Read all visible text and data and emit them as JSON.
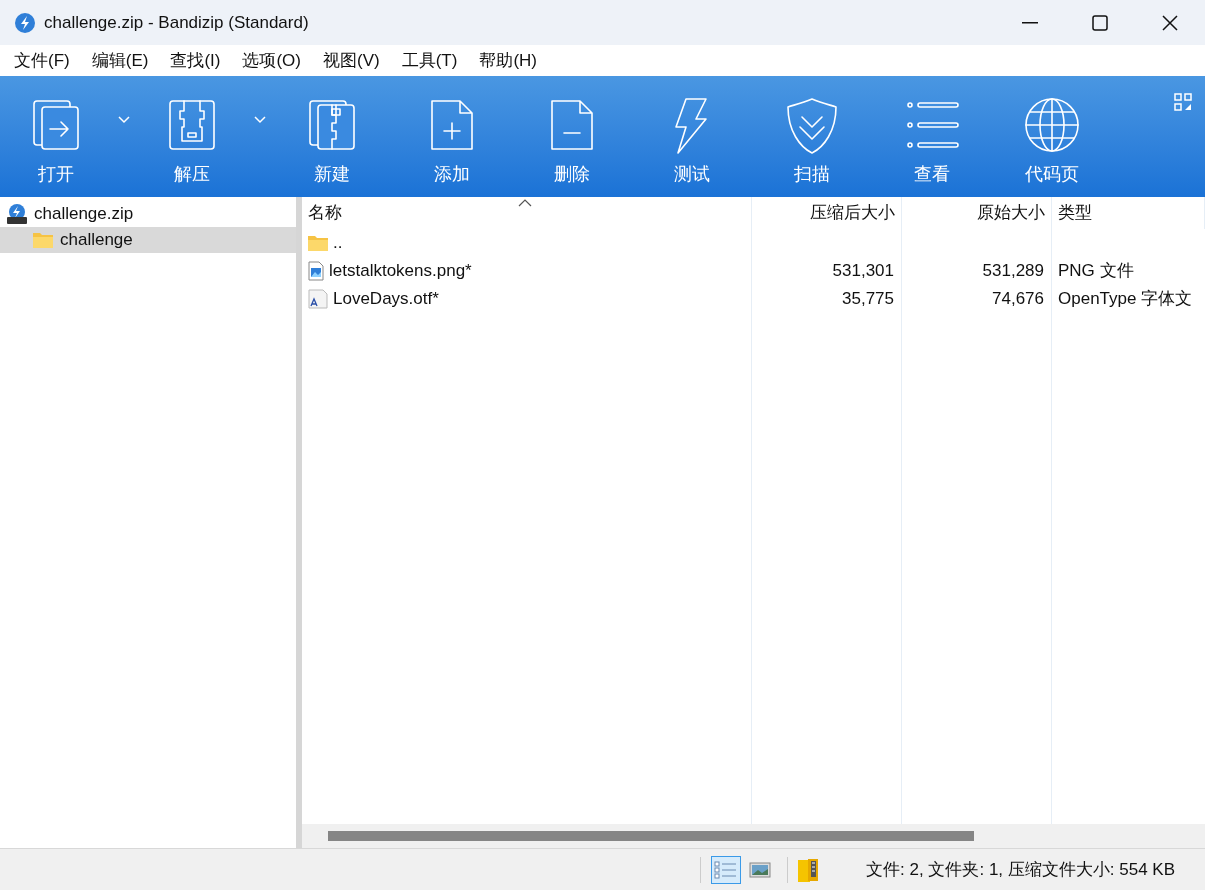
{
  "window": {
    "title": "challenge.zip - Bandizip (Standard)"
  },
  "menu": [
    "文件(F)",
    "编辑(E)",
    "查找(I)",
    "选项(O)",
    "视图(V)",
    "工具(T)",
    "帮助(H)"
  ],
  "toolbar": [
    {
      "label": "打开",
      "dropdown": true
    },
    {
      "label": "解压",
      "dropdown": true
    },
    {
      "label": "新建",
      "dropdown": false
    },
    {
      "label": "添加",
      "dropdown": false
    },
    {
      "label": "删除",
      "dropdown": false
    },
    {
      "label": "测试",
      "dropdown": false
    },
    {
      "label": "扫描",
      "dropdown": false
    },
    {
      "label": "查看",
      "dropdown": false
    },
    {
      "label": "代码页",
      "dropdown": false
    }
  ],
  "tree": [
    {
      "label": "challenge.zip",
      "kind": "archive",
      "selected": false,
      "children": [
        {
          "label": "challenge",
          "kind": "folder",
          "selected": true
        }
      ]
    }
  ],
  "table": {
    "columns": [
      "名称",
      "压缩后大小",
      "原始大小",
      "类型"
    ],
    "rows": [
      {
        "kind": "folder",
        "name": "..",
        "selected": false
      },
      {
        "kind": "image",
        "name": "letstalktokens.png*",
        "packed": "531,301",
        "size": "531,289",
        "type": "PNG 文件",
        "selected": false
      },
      {
        "kind": "font",
        "name": "LoveDays.otf*",
        "packed": "35,775",
        "size": "74,676",
        "type": "OpenType 字体文",
        "selected": false
      }
    ]
  },
  "status_bar": {
    "views": [
      {
        "kind": "details",
        "selected": true
      },
      {
        "kind": "thumbnails",
        "selected": false
      }
    ],
    "text": "文件: 2, 文件夹: 1, 压缩文件大小: 554 KB"
  }
}
